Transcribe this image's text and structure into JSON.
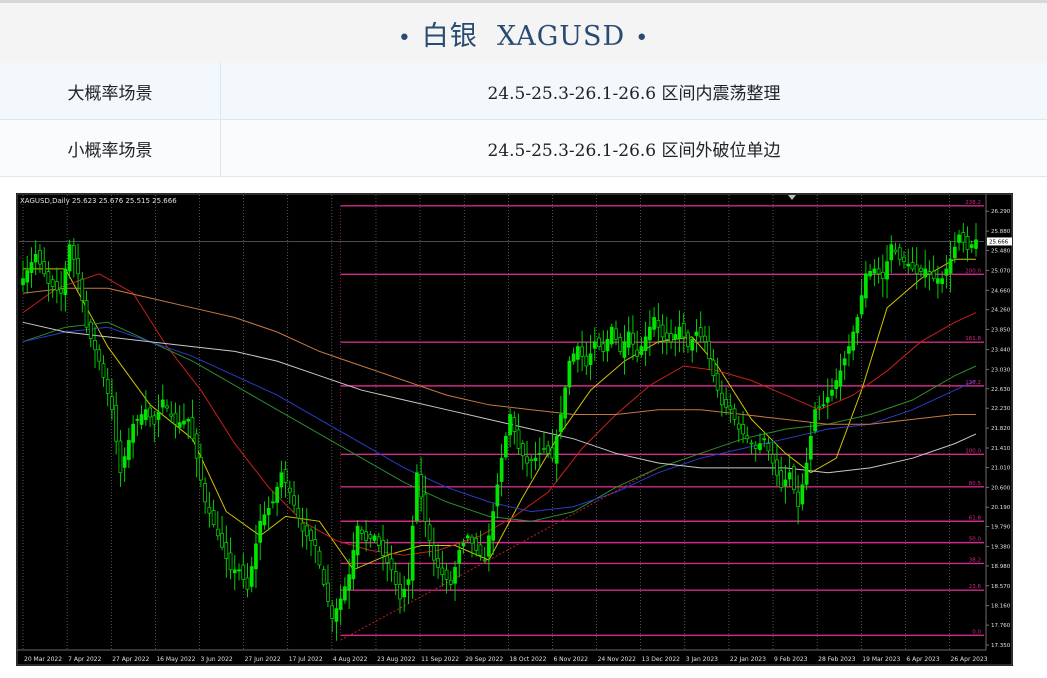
{
  "header": {
    "title": "白银  XAGUSD",
    "bullet": "•"
  },
  "scenarios": [
    {
      "label": "大概率场景",
      "value": "24.5-25.3-26.1-26.6 区间内震荡整理"
    },
    {
      "label": "小概率场景",
      "value": "24.5-25.3-26.1-26.6 区间外破位单边"
    }
  ],
  "colors": {
    "title": "#2a4a72",
    "bull_candle": "#00e400",
    "fib_line": "#d02a8a",
    "ma_yellow": "#d2c400",
    "ma_red": "#c81e1e",
    "ma_green": "#2e8b2e",
    "ma_blue": "#2a3cc8",
    "ma_orange": "#c8783c",
    "ma_white": "#c8c8c8",
    "trendline": "#c81e1e"
  },
  "chart_data": {
    "type": "candlestick",
    "info_label": "XAGUSD,Daily  25.623 25.676 25.515 25.666",
    "price_axis": {
      "ylim": [
        17.35,
        26.5
      ],
      "ticks": [
        "26.290",
        "25.880",
        "25.480",
        "25.070",
        "24.660",
        "24.260",
        "23.850",
        "23.440",
        "23.030",
        "22.630",
        "22.230",
        "21.820",
        "21.410",
        "21.010",
        "20.600",
        "20.190",
        "19.790",
        "19.380",
        "18.980",
        "18.570",
        "18.160",
        "17.760",
        "17.350"
      ],
      "current_price": "25.666"
    },
    "date_axis": {
      "labels": [
        "20 Mar 2022",
        "7 Apr 2022",
        "27 Apr 2022",
        "16 May 2022",
        "3 Jun 2022",
        "27 Jun 2022",
        "17 Jul 2022",
        "4 Aug 2022",
        "23 Aug 2022",
        "11 Sep 2022",
        "29 Sep 2022",
        "18 Oct 2022",
        "6 Nov 2022",
        "24 Nov 2022",
        "13 Dec 2022",
        "3 Jan 2023",
        "22 Jan 2023",
        "9 Feb 2023",
        "28 Feb 2023",
        "19 Mar 2023",
        "6 Apr 2023",
        "26 Apr 2023"
      ]
    },
    "price_path": [
      [
        0,
        24.9
      ],
      [
        3,
        25.4
      ],
      [
        6,
        24.8
      ],
      [
        9,
        24.6
      ],
      [
        11,
        25.6
      ],
      [
        13,
        25.0
      ],
      [
        15,
        23.9
      ],
      [
        18,
        23.2
      ],
      [
        21,
        22.2
      ],
      [
        23,
        20.9
      ],
      [
        26,
        21.9
      ],
      [
        29,
        22.2
      ],
      [
        31,
        21.9
      ],
      [
        33,
        22.4
      ],
      [
        36,
        21.9
      ],
      [
        39,
        22.0
      ],
      [
        41,
        21.2
      ],
      [
        43,
        20.3
      ],
      [
        46,
        19.6
      ],
      [
        49,
        18.9
      ],
      [
        51,
        18.9
      ],
      [
        53,
        18.5
      ],
      [
        56,
        19.9
      ],
      [
        59,
        20.3
      ],
      [
        61,
        20.9
      ],
      [
        63,
        20.5
      ],
      [
        66,
        19.7
      ],
      [
        69,
        19.4
      ],
      [
        71,
        18.6
      ],
      [
        73,
        17.9
      ],
      [
        75,
        18.3
      ],
      [
        77,
        18.8
      ],
      [
        79,
        19.8
      ],
      [
        81,
        19.5
      ],
      [
        83,
        19.6
      ],
      [
        85,
        19.2
      ],
      [
        87,
        18.9
      ],
      [
        89,
        18.3
      ],
      [
        91,
        18.7
      ],
      [
        93,
        20.9
      ],
      [
        95,
        19.9
      ],
      [
        97,
        19.1
      ],
      [
        99,
        18.8
      ],
      [
        101,
        18.6
      ],
      [
        103,
        19.3
      ],
      [
        105,
        19.6
      ],
      [
        107,
        19.3
      ],
      [
        109,
        19.1
      ],
      [
        111,
        20.1
      ],
      [
        113,
        21.2
      ],
      [
        115,
        22.1
      ],
      [
        117,
        21.4
      ],
      [
        119,
        21.1
      ],
      [
        121,
        21.2
      ],
      [
        123,
        21.4
      ],
      [
        125,
        21.2
      ],
      [
        127,
        22.1
      ],
      [
        129,
        23.2
      ],
      [
        131,
        23.5
      ],
      [
        133,
        23.1
      ],
      [
        135,
        23.6
      ],
      [
        137,
        23.4
      ],
      [
        139,
        23.9
      ],
      [
        141,
        23.4
      ],
      [
        143,
        23.8
      ],
      [
        145,
        23.3
      ],
      [
        147,
        23.7
      ],
      [
        149,
        24.1
      ],
      [
        151,
        23.7
      ],
      [
        153,
        23.6
      ],
      [
        155,
        23.9
      ],
      [
        157,
        23.5
      ],
      [
        159,
        23.8
      ],
      [
        161,
        23.6
      ],
      [
        163,
        22.9
      ],
      [
        165,
        22.3
      ],
      [
        167,
        22.2
      ],
      [
        169,
        21.8
      ],
      [
        171,
        21.6
      ],
      [
        173,
        21.4
      ],
      [
        175,
        21.6
      ],
      [
        177,
        21.1
      ],
      [
        179,
        20.6
      ],
      [
        181,
        20.9
      ],
      [
        183,
        20.2
      ],
      [
        185,
        21.1
      ],
      [
        187,
        22.2
      ],
      [
        189,
        22.3
      ],
      [
        191,
        22.6
      ],
      [
        193,
        23.0
      ],
      [
        195,
        23.5
      ],
      [
        197,
        24.1
      ],
      [
        199,
        25.0
      ],
      [
        201,
        25.1
      ],
      [
        203,
        24.9
      ],
      [
        205,
        25.6
      ],
      [
        207,
        25.3
      ],
      [
        209,
        25.2
      ],
      [
        211,
        25.0
      ],
      [
        213,
        25.1
      ],
      [
        215,
        24.9
      ],
      [
        217,
        24.9
      ],
      [
        219,
        25.3
      ],
      [
        221,
        25.8
      ],
      [
        223,
        25.5
      ],
      [
        225,
        25.7
      ]
    ],
    "indicators": {
      "ma_yellow": [
        [
          0,
          25.1
        ],
        [
          10,
          25.1
        ],
        [
          20,
          23.5
        ],
        [
          30,
          22.3
        ],
        [
          40,
          21.6
        ],
        [
          48,
          20.1
        ],
        [
          56,
          19.6
        ],
        [
          62,
          20.0
        ],
        [
          70,
          19.9
        ],
        [
          78,
          18.9
        ],
        [
          86,
          19.2
        ],
        [
          94,
          19.4
        ],
        [
          102,
          19.4
        ],
        [
          110,
          19.1
        ],
        [
          118,
          20.4
        ],
        [
          126,
          21.6
        ],
        [
          134,
          22.6
        ],
        [
          142,
          23.2
        ],
        [
          150,
          23.6
        ],
        [
          158,
          23.7
        ],
        [
          164,
          23.1
        ],
        [
          172,
          22.0
        ],
        [
          180,
          21.3
        ],
        [
          186,
          20.9
        ],
        [
          192,
          21.2
        ],
        [
          198,
          22.6
        ],
        [
          204,
          24.3
        ],
        [
          212,
          24.9
        ],
        [
          220,
          25.3
        ],
        [
          225,
          25.3
        ]
      ],
      "ma_red": [
        [
          0,
          24.2
        ],
        [
          8,
          24.7
        ],
        [
          18,
          25.0
        ],
        [
          26,
          24.6
        ],
        [
          34,
          23.5
        ],
        [
          42,
          22.6
        ],
        [
          50,
          21.5
        ],
        [
          58,
          20.6
        ],
        [
          66,
          19.9
        ],
        [
          74,
          19.5
        ],
        [
          82,
          19.3
        ],
        [
          90,
          19.2
        ],
        [
          98,
          19.3
        ],
        [
          108,
          19.6
        ],
        [
          116,
          20.0
        ],
        [
          124,
          20.5
        ],
        [
          132,
          21.4
        ],
        [
          140,
          22.1
        ],
        [
          148,
          22.7
        ],
        [
          156,
          23.1
        ],
        [
          164,
          23.0
        ],
        [
          172,
          22.8
        ],
        [
          180,
          22.5
        ],
        [
          188,
          22.2
        ],
        [
          196,
          22.5
        ],
        [
          204,
          23.0
        ],
        [
          212,
          23.6
        ],
        [
          220,
          24.0
        ],
        [
          225,
          24.2
        ]
      ],
      "ma_green": [
        [
          0,
          23.6
        ],
        [
          10,
          23.9
        ],
        [
          20,
          24.0
        ],
        [
          30,
          23.6
        ],
        [
          40,
          23.2
        ],
        [
          50,
          22.7
        ],
        [
          60,
          22.2
        ],
        [
          70,
          21.7
        ],
        [
          80,
          21.2
        ],
        [
          90,
          20.7
        ],
        [
          100,
          20.3
        ],
        [
          110,
          20.0
        ],
        [
          120,
          19.9
        ],
        [
          130,
          20.1
        ],
        [
          140,
          20.6
        ],
        [
          150,
          21.0
        ],
        [
          160,
          21.3
        ],
        [
          170,
          21.6
        ],
        [
          180,
          21.8
        ],
        [
          190,
          21.9
        ],
        [
          200,
          22.1
        ],
        [
          210,
          22.4
        ],
        [
          220,
          22.9
        ],
        [
          225,
          23.1
        ]
      ],
      "ma_blue": [
        [
          0,
          23.6
        ],
        [
          10,
          23.8
        ],
        [
          20,
          23.9
        ],
        [
          30,
          23.6
        ],
        [
          40,
          23.3
        ],
        [
          50,
          22.9
        ],
        [
          60,
          22.5
        ],
        [
          70,
          22.0
        ],
        [
          80,
          21.5
        ],
        [
          90,
          21.0
        ],
        [
          100,
          20.6
        ],
        [
          110,
          20.3
        ],
        [
          120,
          20.1
        ],
        [
          130,
          20.2
        ],
        [
          140,
          20.5
        ],
        [
          150,
          20.9
        ],
        [
          160,
          21.2
        ],
        [
          170,
          21.4
        ],
        [
          180,
          21.6
        ],
        [
          190,
          21.8
        ],
        [
          200,
          21.9
        ],
        [
          210,
          22.2
        ],
        [
          220,
          22.6
        ],
        [
          225,
          22.8
        ]
      ],
      "ma_orange": [
        [
          0,
          24.6
        ],
        [
          10,
          24.7
        ],
        [
          20,
          24.7
        ],
        [
          30,
          24.5
        ],
        [
          40,
          24.3
        ],
        [
          50,
          24.1
        ],
        [
          60,
          23.8
        ],
        [
          70,
          23.4
        ],
        [
          80,
          23.1
        ],
        [
          90,
          22.8
        ],
        [
          100,
          22.5
        ],
        [
          110,
          22.3
        ],
        [
          120,
          22.2
        ],
        [
          130,
          22.1
        ],
        [
          140,
          22.1
        ],
        [
          150,
          22.2
        ],
        [
          160,
          22.2
        ],
        [
          170,
          22.1
        ],
        [
          180,
          22.0
        ],
        [
          190,
          21.9
        ],
        [
          200,
          21.9
        ],
        [
          210,
          22.0
        ],
        [
          220,
          22.1
        ],
        [
          225,
          22.1
        ]
      ],
      "ma_white": [
        [
          0,
          24.0
        ],
        [
          10,
          23.8
        ],
        [
          20,
          23.7
        ],
        [
          30,
          23.6
        ],
        [
          40,
          23.5
        ],
        [
          50,
          23.4
        ],
        [
          60,
          23.2
        ],
        [
          70,
          22.9
        ],
        [
          80,
          22.6
        ],
        [
          90,
          22.4
        ],
        [
          100,
          22.2
        ],
        [
          110,
          22.0
        ],
        [
          120,
          21.8
        ],
        [
          130,
          21.6
        ],
        [
          140,
          21.3
        ],
        [
          150,
          21.1
        ],
        [
          160,
          21.0
        ],
        [
          170,
          21.0
        ],
        [
          180,
          21.0
        ],
        [
          190,
          20.9
        ],
        [
          200,
          21.0
        ],
        [
          210,
          21.2
        ],
        [
          220,
          21.5
        ],
        [
          225,
          21.7
        ]
      ],
      "trendline": [
        [
          75,
          17.45
        ],
        [
          110,
          19.1
        ],
        [
          150,
          21.0
        ]
      ]
    },
    "fib_levels": [
      {
        "price": 26.4,
        "label": "238.2"
      },
      {
        "price": 24.99,
        "label": "200.0"
      },
      {
        "price": 23.59,
        "label": "161.8"
      },
      {
        "price": 22.69,
        "label": "138.2"
      },
      {
        "price": 21.28,
        "label": "100.0"
      },
      {
        "price": 20.61,
        "label": "80.5"
      },
      {
        "price": 19.9,
        "label": "61.8"
      },
      {
        "price": 19.46,
        "label": "50.0"
      },
      {
        "price": 19.03,
        "label": "38.2"
      },
      {
        "price": 18.48,
        "label": "23.6"
      },
      {
        "price": 17.55,
        "label": "0.0"
      }
    ],
    "fib_start_index": 75,
    "grid": true
  }
}
